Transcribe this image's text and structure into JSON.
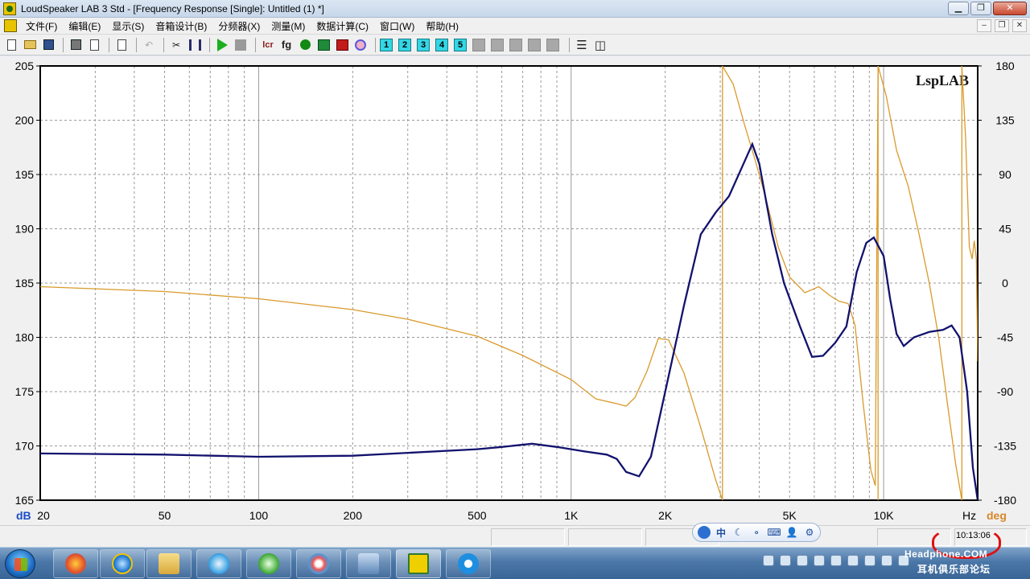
{
  "window": {
    "title": "LoudSpeaker LAB 3 Std - [Frequency Response [Single]: Untitled (1) *]",
    "minimize": "▁",
    "restore": "❐",
    "close": "✕"
  },
  "menu": {
    "items": [
      "文件(F)",
      "编辑(E)",
      "显示(S)",
      "音箱设计(B)",
      "分频器(X)",
      "测量(M)",
      "数据计算(C)",
      "窗口(W)",
      "帮助(H)"
    ],
    "mdi_min": "–",
    "mdi_restore": "❐",
    "mdi_close": "✕"
  },
  "toolbar": {
    "text_buttons": {
      "lcr": "lcr",
      "fg": "fg"
    },
    "channel_buttons": [
      "1",
      "2",
      "3",
      "4",
      "5"
    ]
  },
  "chart_data": {
    "type": "line",
    "title": "",
    "watermark": "LspLAB",
    "xlabel": "Hz",
    "ylabel_left": "dB",
    "ylabel_right": "deg",
    "x_scale": "log",
    "xlim": [
      20,
      20000
    ],
    "ylim_left": [
      165,
      205
    ],
    "ylim_right": [
      -180,
      180
    ],
    "x_ticks": [
      {
        "value": 20,
        "label": "20"
      },
      {
        "value": 50,
        "label": "50"
      },
      {
        "value": 100,
        "label": "100"
      },
      {
        "value": 200,
        "label": "200"
      },
      {
        "value": 500,
        "label": "500"
      },
      {
        "value": 1000,
        "label": "1K"
      },
      {
        "value": 2000,
        "label": "2K"
      },
      {
        "value": 5000,
        "label": "5K"
      },
      {
        "value": 10000,
        "label": "10K"
      }
    ],
    "y_ticks_left": [
      "205",
      "200",
      "195",
      "190",
      "185",
      "180",
      "175",
      "170",
      "165"
    ],
    "y_ticks_right": [
      "180",
      "135",
      "90",
      "45",
      "0",
      "-45",
      "-90",
      "-135",
      "-180"
    ],
    "grid": true,
    "colors": {
      "magnitude": "#12126e",
      "phase": "#d99a2b",
      "plot_background": "#ffffff",
      "grid": "#9a9a9a"
    },
    "series": [
      {
        "axis": "left",
        "color": "#12126e",
        "points": [
          [
            20,
            169.3
          ],
          [
            50,
            169.2
          ],
          [
            100,
            169.0
          ],
          [
            200,
            169.1
          ],
          [
            500,
            169.7
          ],
          [
            600,
            169.9
          ],
          [
            750,
            170.2
          ],
          [
            900,
            169.9
          ],
          [
            1100,
            169.5
          ],
          [
            1300,
            169.2
          ],
          [
            1400,
            168.8
          ],
          [
            1500,
            167.6
          ],
          [
            1650,
            167.2
          ],
          [
            1800,
            169.0
          ],
          [
            2000,
            175.0
          ],
          [
            2300,
            183.0
          ],
          [
            2600,
            189.5
          ],
          [
            2900,
            191.5
          ],
          [
            3200,
            193.0
          ],
          [
            3500,
            195.5
          ],
          [
            3800,
            197.8
          ],
          [
            4000,
            196.0
          ],
          [
            4400,
            189.5
          ],
          [
            4800,
            185.0
          ],
          [
            5400,
            181.0
          ],
          [
            5900,
            178.2
          ],
          [
            6400,
            178.3
          ],
          [
            7000,
            179.5
          ],
          [
            7600,
            181.0
          ],
          [
            8200,
            186.0
          ],
          [
            8800,
            188.7
          ],
          [
            9300,
            189.2
          ],
          [
            10000,
            187.5
          ],
          [
            10500,
            183.5
          ],
          [
            11000,
            180.3
          ],
          [
            11600,
            179.2
          ],
          [
            12500,
            180.0
          ],
          [
            14000,
            180.5
          ],
          [
            15500,
            180.7
          ],
          [
            16500,
            181.1
          ],
          [
            17500,
            180.0
          ],
          [
            18500,
            175.0
          ],
          [
            19300,
            168.0
          ],
          [
            20000,
            165.0
          ]
        ]
      },
      {
        "axis": "right",
        "color": "#d99a2b",
        "segments": [
          [
            [
              20,
              -3
            ],
            [
              50,
              -7
            ],
            [
              100,
              -13
            ],
            [
              200,
              -22
            ],
            [
              300,
              -30
            ],
            [
              500,
              -44
            ],
            [
              700,
              -60
            ],
            [
              1000,
              -80
            ],
            [
              1200,
              -96
            ],
            [
              1400,
              -100
            ],
            [
              1500,
              -102
            ],
            [
              1600,
              -95
            ],
            [
              1750,
              -73
            ],
            [
              1900,
              -46
            ],
            [
              2050,
              -47
            ],
            [
              2300,
              -75
            ],
            [
              2600,
              -120
            ],
            [
              2900,
              -163
            ],
            [
              3050,
              -180
            ]
          ],
          [
            [
              3050,
              180
            ],
            [
              3300,
              165
            ],
            [
              3600,
              130
            ],
            [
              3900,
              100
            ],
            [
              4200,
              70
            ],
            [
              4600,
              30
            ],
            [
              5000,
              5
            ],
            [
              5600,
              -8
            ],
            [
              6200,
              -3
            ],
            [
              6700,
              -10
            ],
            [
              7200,
              -15
            ],
            [
              7700,
              -17
            ],
            [
              8100,
              -35
            ],
            [
              8600,
              -100
            ],
            [
              9100,
              -155
            ],
            [
              9400,
              -168
            ],
            [
              9600,
              180
            ]
          ],
          [
            [
              9600,
              180
            ],
            [
              10200,
              155
            ],
            [
              11000,
              110
            ],
            [
              12000,
              80
            ],
            [
              13000,
              40
            ],
            [
              14000,
              0
            ],
            [
              15000,
              -45
            ],
            [
              16000,
              -100
            ],
            [
              17000,
              -150
            ],
            [
              17800,
              -180
            ]
          ],
          [
            [
              17800,
              180
            ],
            [
              18300,
              120
            ],
            [
              18800,
              30
            ],
            [
              19200,
              20
            ],
            [
              19500,
              35
            ],
            [
              19800,
              20
            ],
            [
              20000,
              -65
            ]
          ]
        ]
      }
    ]
  },
  "status": {
    "time": "10:13:06",
    "ime": [
      "中",
      "☾",
      "∘",
      "⌨",
      "👤",
      "⚙"
    ]
  },
  "watermark": {
    "line1": "Headphone.COM",
    "line2": "耳机俱乐部论坛"
  }
}
